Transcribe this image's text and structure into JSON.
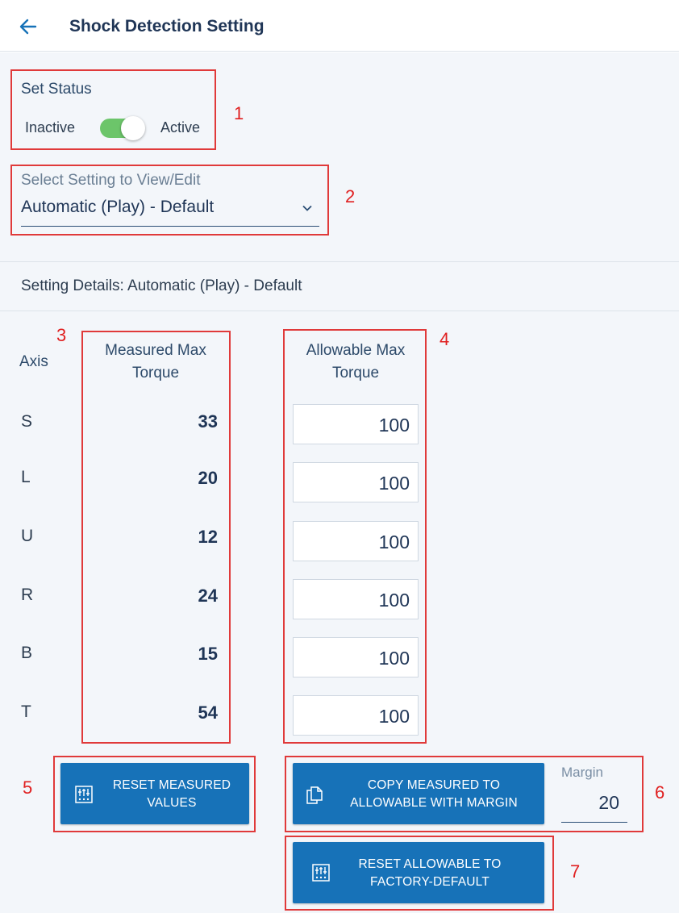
{
  "header": {
    "title": "Shock Detection Setting",
    "back_icon": "arrow-left-icon"
  },
  "status": {
    "label": "Set Status",
    "inactive_label": "Inactive",
    "active_label": "Active",
    "is_active": true,
    "accent": "#6cc56a"
  },
  "setting_select": {
    "caption": "Select Setting to View/Edit",
    "selected": "Automatic (Play) - Default"
  },
  "details": {
    "heading": "Setting Details: Automatic (Play) - Default",
    "axis_header": "Axis",
    "measured_header_line1": "Measured Max",
    "measured_header_line2": "Torque",
    "allowable_header_line1": "Allowable Max",
    "allowable_header_line2": "Torque",
    "rows": [
      {
        "axis": "S",
        "measured": "33",
        "allowable": "100"
      },
      {
        "axis": "L",
        "measured": "20",
        "allowable": "100"
      },
      {
        "axis": "U",
        "measured": "12",
        "allowable": "100"
      },
      {
        "axis": "R",
        "measured": "24",
        "allowable": "100"
      },
      {
        "axis": "B",
        "measured": "15",
        "allowable": "100"
      },
      {
        "axis": "T",
        "measured": "54",
        "allowable": "100"
      }
    ]
  },
  "actions": {
    "reset_measured_line1": "RESET MEASURED",
    "reset_measured_line2": "VALUES",
    "copy_line1": "COPY MEASURED TO",
    "copy_line2": "ALLOWABLE WITH MARGIN",
    "margin_label": "Margin",
    "margin_value": "20",
    "reset_allowable_line1": "RESET ALLOWABLE TO",
    "reset_allowable_line2": "FACTORY-DEFAULT",
    "button_color": "#1772b8"
  },
  "annotations": [
    "1",
    "2",
    "3",
    "4",
    "5",
    "6",
    "7"
  ],
  "annotation_color": "#e02020"
}
